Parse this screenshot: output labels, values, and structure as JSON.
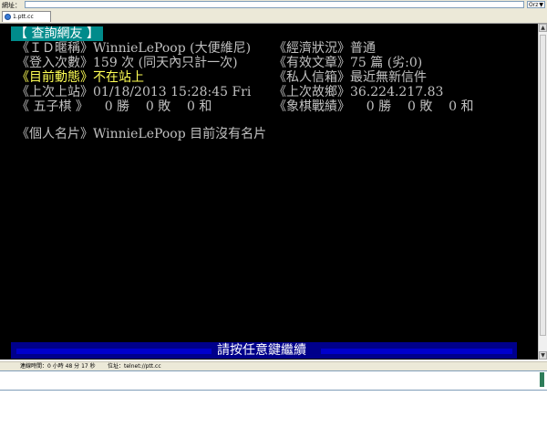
{
  "address_bar": {
    "label": "網址：",
    "go_label": "Orz"
  },
  "tab": {
    "title": "1.ptt.cc"
  },
  "terminal": {
    "title": "【 查詢網友 】",
    "rows": [
      {
        "left": "《ＩＤ暱稱》WinnieLePoop (大便維尼)",
        "right": "《經濟狀況》普通"
      },
      {
        "left": "《登入次數》159 次 (同天內只計一次)",
        "right": "《有效文章》75 篇 (劣:0)"
      },
      {
        "left": "《目前動態》不在站上",
        "right": "《私人信箱》最近無新信件"
      },
      {
        "left": "《上次上站》01/18/2013 15:28:45 Fri",
        "right": "《上次故鄉》36.224.217.83"
      },
      {
        "left": "《 五子棋 》    0 勝    0 敗    0 和",
        "right": "《象棋戰績》    0 勝    0 敗    0 和"
      }
    ],
    "card": "《個人名片》WinnieLePoop 目前沒有名片",
    "continue_prompt": "請按任意鍵繼續"
  },
  "status_bar": {
    "elapsed": "連線時間：0 小時 48 分 17 秒",
    "address": "位址：telnet://ptt.cc"
  },
  "colors": {
    "terminal_bg": "#000000",
    "title_bg": "#008b8b",
    "highlight": "#ffff55",
    "bottom_bar": "#00008b"
  }
}
